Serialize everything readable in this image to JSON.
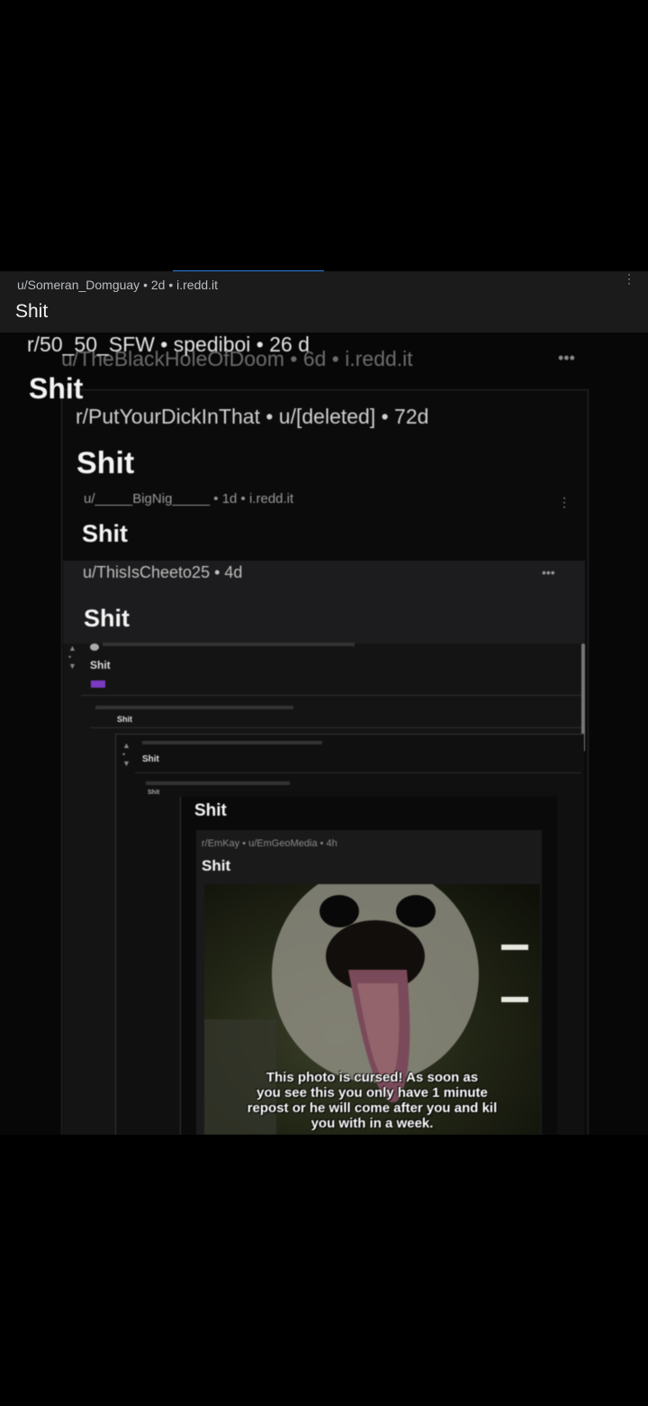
{
  "post": {
    "meta": "u/Someran_Domguay • 2d • i.redd.it",
    "title": "Shit",
    "more_icon": "vertical-dots-icon"
  },
  "screenshot": {
    "level1": {
      "subreddit_line": "r/50_50_SFW • spediboi • 26 d",
      "meta": "u/TheBlackHoleOfDoom • 6d • i.redd.it",
      "title": "Shit"
    },
    "level2": {
      "meta": "r/PutYourDickInThat • u/[deleted] • 72d",
      "title": "Shit"
    },
    "level3": {
      "meta": "u/_____BigNig_____ • 1d • i.redd.it",
      "title": "Shit"
    },
    "level4": {
      "meta": "u/ThisIsCheeto25 • 4d",
      "title": "Shit"
    },
    "level5": {
      "title": "Shit",
      "sub_title": "Shit",
      "inner_title": "Shit",
      "inner_sub": "Shit"
    },
    "level6": {
      "title": "Shit"
    },
    "level7": {
      "meta": "r/EmKay • u/EmGeoMedia • 4h",
      "title": "Shit"
    },
    "cursed_caption": [
      "This photo is cursed! As soon as",
      "you see this you only have 1 minute",
      "repost or he will come after you and kil",
      "you with in a week."
    ],
    "ellipsis": "•••",
    "dots_vertical": "⋮"
  }
}
